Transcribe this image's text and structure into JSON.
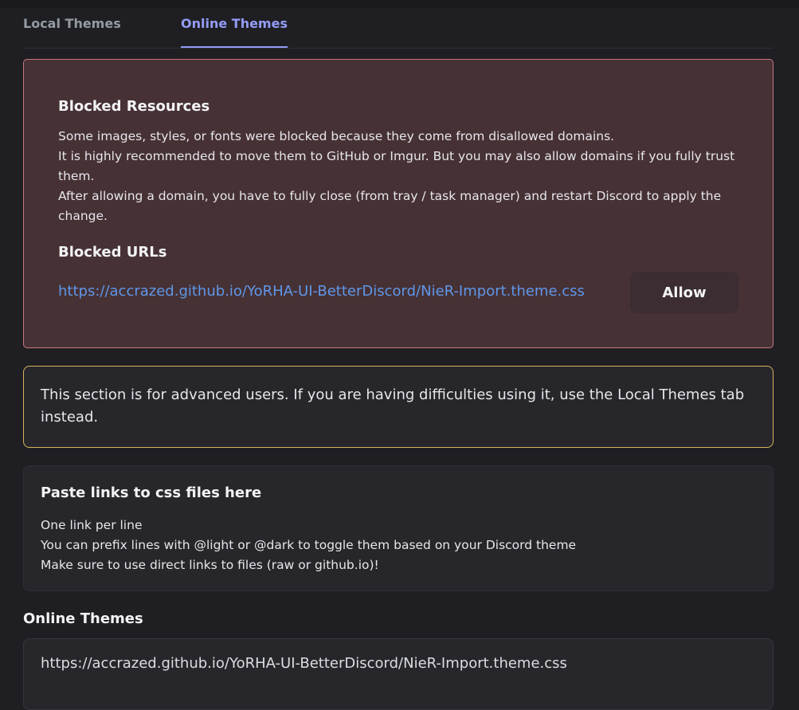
{
  "tabs": [
    {
      "label": "Local Themes",
      "active": false
    },
    {
      "label": "Online Themes",
      "active": true
    }
  ],
  "blocked": {
    "title": "Blocked Resources",
    "lines": [
      "Some images, styles, or fonts were blocked because they come from disallowed domains.",
      "It is highly recommended to move them to GitHub or Imgur. But you may also allow domains if you fully trust them.",
      "After allowing a domain, you have to fully close (from tray / task manager) and restart Discord to apply the change."
    ],
    "urls_title": "Blocked URLs",
    "urls": [
      {
        "url": "https://accrazed.github.io/YoRHA-UI-BetterDiscord/NieR-Import.theme.css",
        "button": "Allow"
      }
    ]
  },
  "warning": {
    "text": "This section is for advanced users. If you are having difficulties using it, use the Local Themes tab instead."
  },
  "paste": {
    "title": "Paste links to css files here",
    "lines": [
      "One link per line",
      "You can prefix lines with @light or @dark to toggle them based on your Discord theme",
      "Make sure to use direct links to files (raw or github.io)!"
    ]
  },
  "online_themes": {
    "title": "Online Themes",
    "value": "https://accrazed.github.io/YoRHA-UI-BetterDiscord/NieR-Import.theme.css"
  },
  "colors": {
    "accent": "#949cf7",
    "link": "#5f97e8",
    "danger_border": "#c6777b",
    "warning_border": "#d6b45f"
  }
}
